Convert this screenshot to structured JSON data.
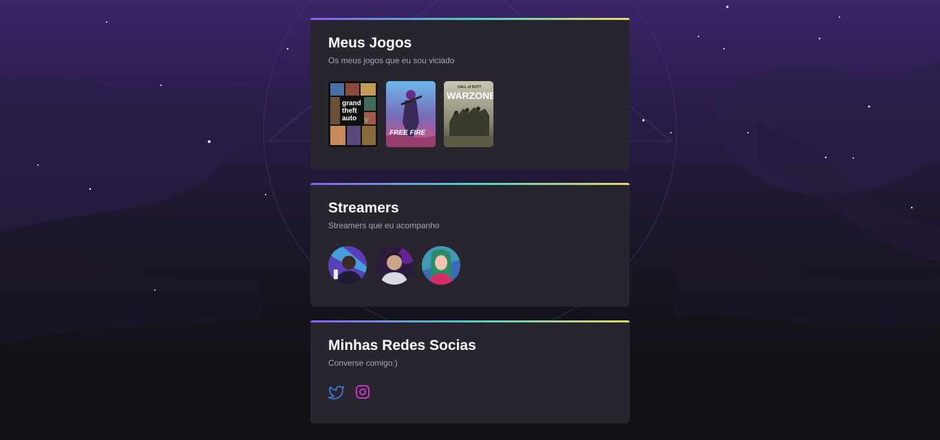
{
  "games_card": {
    "title": "Meus Jogos",
    "subtitle": "Os meus jogos que eu sou viciado",
    "games": [
      {
        "label": "GTA V",
        "cover_lines": [
          "grand",
          "theft",
          "auto"
        ]
      },
      {
        "label": "Free Fire",
        "cover_text": "FREE FIRE"
      },
      {
        "label": "Warzone",
        "cover_small": "CALL of DUTY",
        "cover_text": "WARZONE"
      }
    ]
  },
  "streamers_card": {
    "title": "Streamers",
    "subtitle": "Streamers que eu acompanho"
  },
  "socials_card": {
    "title": "Minhas Redes Socias",
    "subtitle": "Converse comigo:)",
    "links": [
      {
        "icon": "twitter-icon",
        "color": "#3b7bdc"
      },
      {
        "icon": "instagram-icon",
        "color": "#d63ad0"
      }
    ]
  },
  "colors": {
    "card_bg": "#29252f",
    "accent_gradient": [
      "#8c5cf5",
      "#4fd1c5",
      "#e8d86a"
    ]
  }
}
